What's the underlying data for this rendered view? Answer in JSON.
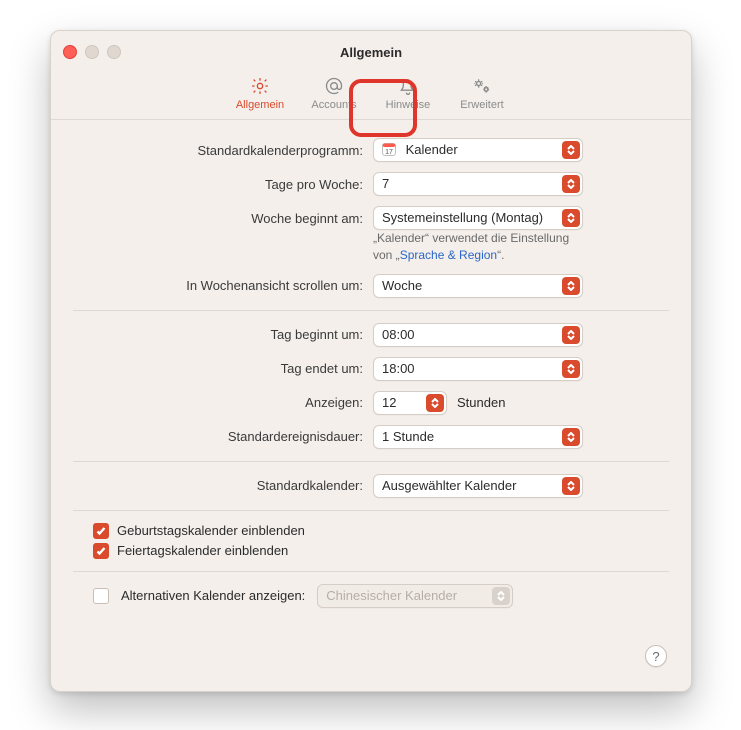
{
  "window": {
    "title": "Allgemein"
  },
  "tabs": [
    {
      "label": "Allgemein"
    },
    {
      "label": "Accounts"
    },
    {
      "label": "Hinweise"
    },
    {
      "label": "Erweitert"
    }
  ],
  "rows": {
    "default_app": {
      "label": "Standardkalenderprogramm:",
      "value": "Kalender"
    },
    "days_per_week": {
      "label": "Tage pro Woche:",
      "value": "7"
    },
    "week_start": {
      "label": "Woche beginnt am:",
      "value": "Systemeinstellung (Montag)",
      "hint_pre": "„Kalender“ verwendet die Einstellung von „",
      "hint_link": "Sprache & Region",
      "hint_post": "“."
    },
    "scroll_week": {
      "label": "In Wochenansicht scrollen um:",
      "value": "Woche"
    },
    "day_start": {
      "label": "Tag beginnt um:",
      "value": "08:00"
    },
    "day_end": {
      "label": "Tag endet um:",
      "value": "18:00"
    },
    "show_hours": {
      "label": "Anzeigen:",
      "value": "12",
      "unit": "Stunden"
    },
    "default_duration": {
      "label": "Standardereignisdauer:",
      "value": "1 Stunde"
    },
    "default_calendar": {
      "label": "Standardkalender:",
      "value": "Ausgewählter Kalender"
    }
  },
  "checks": {
    "birthday": "Geburtstagskalender einblenden",
    "holiday": "Feiertagskalender einblenden",
    "alt_label": "Alternativen Kalender anzeigen:",
    "alt_value": "Chinesischer Kalender"
  },
  "help": "?"
}
